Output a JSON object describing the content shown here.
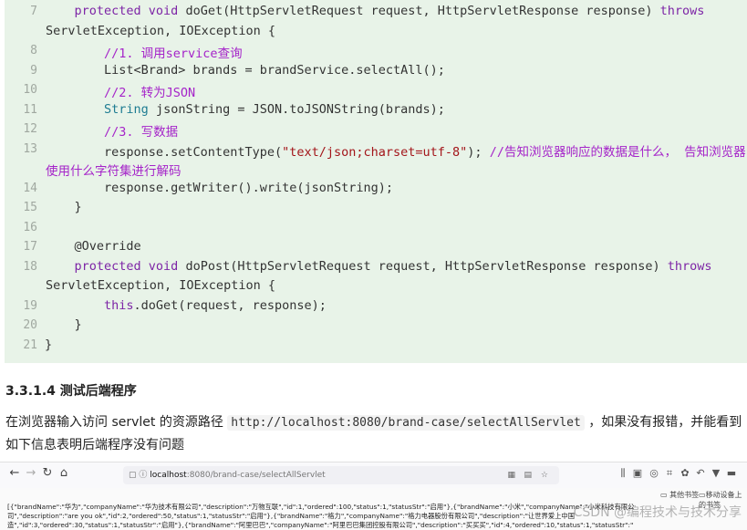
{
  "code": {
    "lines": [
      {
        "num": "7",
        "tokens": [
          [
            "    ",
            ""
          ],
          [
            "protected void ",
            "kw"
          ],
          [
            "doGet(HttpServletRequest request, HttpServletResponse response) ",
            ""
          ],
          [
            "throws",
            "kw"
          ]
        ]
      },
      {
        "num": "",
        "tokens": [
          [
            "ServletException, IOException {",
            ""
          ]
        ]
      },
      {
        "num": "8",
        "tokens": [
          [
            "        ",
            ""
          ],
          [
            "//1. 调用service查询",
            "com"
          ]
        ]
      },
      {
        "num": "9",
        "tokens": [
          [
            "        List<Brand> brands = brandService.selectAll();",
            ""
          ]
        ]
      },
      {
        "num": "10",
        "tokens": [
          [
            "        ",
            ""
          ],
          [
            "//2. 转为JSON",
            "com"
          ]
        ]
      },
      {
        "num": "11",
        "tokens": [
          [
            "        ",
            ""
          ],
          [
            "String",
            "cls"
          ],
          [
            " jsonString = JSON.toJSONString(brands);",
            ""
          ]
        ]
      },
      {
        "num": "12",
        "tokens": [
          [
            "        ",
            ""
          ],
          [
            "//3. 写数据",
            "com"
          ]
        ]
      },
      {
        "num": "13",
        "tokens": [
          [
            "        response.setContentType(",
            ""
          ],
          [
            "\"text/json;charset=utf-8\"",
            "str"
          ],
          [
            "); ",
            ""
          ],
          [
            "//告知浏览器响应的数据是什么， 告知浏览器",
            "com"
          ]
        ]
      },
      {
        "num": "",
        "tokens": [
          [
            "使用什么字符集进行解码",
            "com"
          ]
        ]
      },
      {
        "num": "14",
        "tokens": [
          [
            "        response.getWriter().write(jsonString);",
            ""
          ]
        ]
      },
      {
        "num": "15",
        "tokens": [
          [
            "    }",
            ""
          ]
        ]
      },
      {
        "num": "16",
        "tokens": []
      },
      {
        "num": "17",
        "tokens": [
          [
            "    @Override",
            ""
          ]
        ]
      },
      {
        "num": "18",
        "tokens": [
          [
            "    ",
            ""
          ],
          [
            "protected void ",
            "kw"
          ],
          [
            "doPost(HttpServletRequest request, HttpServletResponse response) ",
            ""
          ],
          [
            "throws",
            "kw"
          ]
        ]
      },
      {
        "num": "",
        "tokens": [
          [
            "ServletException, IOException {",
            ""
          ]
        ]
      },
      {
        "num": "19",
        "tokens": [
          [
            "        ",
            ""
          ],
          [
            "this",
            "kw"
          ],
          [
            ".doGet(request, response);",
            ""
          ]
        ]
      },
      {
        "num": "20",
        "tokens": [
          [
            "    }",
            ""
          ]
        ]
      },
      {
        "num": "21",
        "tokens": [
          [
            "}",
            ""
          ]
        ]
      }
    ]
  },
  "heading": "3.3.1.4 测试后端程序",
  "paragraph": {
    "before": "在浏览器输入访问 servlet 的资源路径 ",
    "url": "http://localhost:8080/brand-case/selectAllServlet",
    "after": " ，如果没有报错，并能看到如下信息表明后端程序没有问题"
  },
  "browser": {
    "host": "localhost",
    "path": ":8080/brand-case/selectAllServlet",
    "bookmarks": [
      "其他书签",
      "移动设备上的书签"
    ],
    "json_lines": [
      "[{\"brandName\":\"华为\",\"companyName\":\"华为技术有限公司\",\"description\":\"万物互联\",\"id\":1,\"ordered\":100,\"status\":1,\"statusStr\":\"启用\"},{\"brandName\":\"小米\",\"companyName\":\"小米科技有限公",
      "司\",\"description\":\"are you ok\",\"id\":2,\"ordered\":50,\"status\":1,\"statusStr\":\"启用\"},{\"brandName\":\"格力\",\"companyName\":\"格力电器股份有限公司\",\"description\":\"让世界爱上中国",
      "造\",\"id\":3,\"ordered\":30,\"status\":1,\"statusStr\":\"启用\"},{\"brandName\":\"阿里巴巴\",\"companyName\":\"阿里巴巴集团控股有限公司\",\"description\":\"买买买\",\"id\":4,\"ordered\":10,\"status\":1,\"statusStr\":\""
    ],
    "watermark": "CSDN @编程技术与技术分享"
  }
}
